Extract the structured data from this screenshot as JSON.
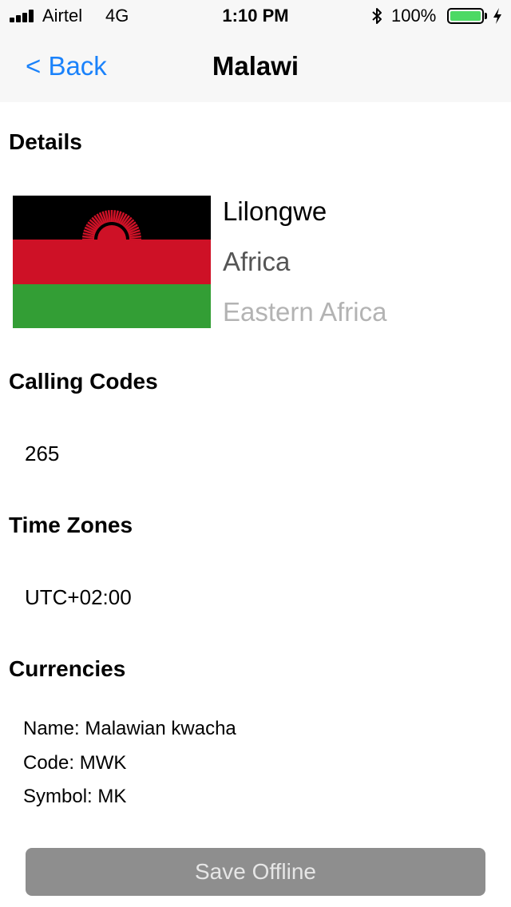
{
  "status_bar": {
    "carrier": "Airtel",
    "network": "4G",
    "time": "1:10 PM",
    "battery_percent": "100%",
    "battery_level": 1.0,
    "signal_bars_filled": 4
  },
  "nav": {
    "back_label": "< Back",
    "title": "Malawi"
  },
  "details": {
    "header": "Details",
    "capital": "Lilongwe",
    "region": "Africa",
    "subregion": "Eastern Africa",
    "flag_colors": {
      "top": "#000000",
      "middle": "#ce1126",
      "bottom": "#339e35",
      "sun": "#ce1126"
    }
  },
  "calling_codes": {
    "header": "Calling Codes",
    "value": "265"
  },
  "time_zones": {
    "header": "Time Zones",
    "value": "UTC+02:00"
  },
  "currencies": {
    "header": "Currencies",
    "name": "Name: Malawian kwacha",
    "code": "Code: MWK",
    "symbol": "Symbol: MK"
  },
  "save_button": {
    "label": "Save Offline"
  },
  "colors": {
    "accent": "#1a82fb",
    "button_bg": "#8e8e8e",
    "battery_green": "#4cd964"
  }
}
